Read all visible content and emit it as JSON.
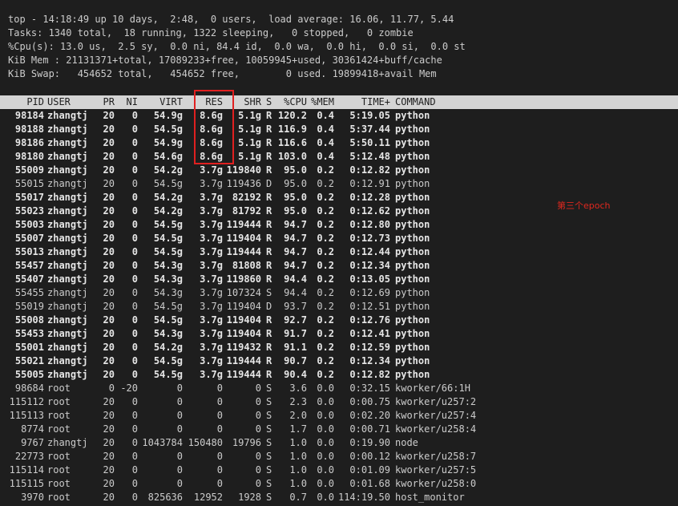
{
  "summary": [
    "top - 14:18:49 up 10 days,  2:48,  0 users,  load average: 16.06, 11.77, 5.44",
    "Tasks: 1340 total,  18 running, 1322 sleeping,   0 stopped,   0 zombie",
    "%Cpu(s): 13.0 us,  2.5 sy,  0.0 ni, 84.4 id,  0.0 wa,  0.0 hi,  0.0 si,  0.0 st",
    "KiB Mem : 21131371+total, 17089233+free, 10059945+used, 30361424+buff/cache",
    "KiB Swap:   454652 total,   454652 free,        0 used. 19899418+avail Mem"
  ],
  "columns": [
    "PID",
    "USER",
    "PR",
    "NI",
    "VIRT",
    "RES",
    "SHR",
    "S",
    "%CPU",
    "%MEM",
    "TIME+",
    "COMMAND"
  ],
  "processes": [
    {
      "pid": "98184",
      "user": "zhangtj",
      "pr": "20",
      "ni": "0",
      "virt": "54.9g",
      "res": "8.6g",
      "shr": "5.1g",
      "s": "R",
      "cpu": "120.2",
      "mem": "0.4",
      "time": "5:19.05",
      "cmd": "python",
      "bold": true
    },
    {
      "pid": "98188",
      "user": "zhangtj",
      "pr": "20",
      "ni": "0",
      "virt": "54.5g",
      "res": "8.6g",
      "shr": "5.1g",
      "s": "R",
      "cpu": "116.9",
      "mem": "0.4",
      "time": "5:37.44",
      "cmd": "python",
      "bold": true
    },
    {
      "pid": "98186",
      "user": "zhangtj",
      "pr": "20",
      "ni": "0",
      "virt": "54.9g",
      "res": "8.6g",
      "shr": "5.1g",
      "s": "R",
      "cpu": "116.6",
      "mem": "0.4",
      "time": "5:50.11",
      "cmd": "python",
      "bold": true
    },
    {
      "pid": "98180",
      "user": "zhangtj",
      "pr": "20",
      "ni": "0",
      "virt": "54.6g",
      "res": "8.6g",
      "shr": "5.1g",
      "s": "R",
      "cpu": "103.0",
      "mem": "0.4",
      "time": "5:12.48",
      "cmd": "python",
      "bold": true
    },
    {
      "pid": "55009",
      "user": "zhangtj",
      "pr": "20",
      "ni": "0",
      "virt": "54.2g",
      "res": "3.7g",
      "shr": "119840",
      "s": "R",
      "cpu": "95.0",
      "mem": "0.2",
      "time": "0:12.82",
      "cmd": "python",
      "bold": true
    },
    {
      "pid": "55015",
      "user": "zhangtj",
      "pr": "20",
      "ni": "0",
      "virt": "54.5g",
      "res": "3.7g",
      "shr": "119436",
      "s": "D",
      "cpu": "95.0",
      "mem": "0.2",
      "time": "0:12.91",
      "cmd": "python",
      "bold": false
    },
    {
      "pid": "55017",
      "user": "zhangtj",
      "pr": "20",
      "ni": "0",
      "virt": "54.2g",
      "res": "3.7g",
      "shr": "82192",
      "s": "R",
      "cpu": "95.0",
      "mem": "0.2",
      "time": "0:12.28",
      "cmd": "python",
      "bold": true
    },
    {
      "pid": "55023",
      "user": "zhangtj",
      "pr": "20",
      "ni": "0",
      "virt": "54.2g",
      "res": "3.7g",
      "shr": "81792",
      "s": "R",
      "cpu": "95.0",
      "mem": "0.2",
      "time": "0:12.62",
      "cmd": "python",
      "bold": true
    },
    {
      "pid": "55003",
      "user": "zhangtj",
      "pr": "20",
      "ni": "0",
      "virt": "54.5g",
      "res": "3.7g",
      "shr": "119444",
      "s": "R",
      "cpu": "94.7",
      "mem": "0.2",
      "time": "0:12.80",
      "cmd": "python",
      "bold": true
    },
    {
      "pid": "55007",
      "user": "zhangtj",
      "pr": "20",
      "ni": "0",
      "virt": "54.5g",
      "res": "3.7g",
      "shr": "119404",
      "s": "R",
      "cpu": "94.7",
      "mem": "0.2",
      "time": "0:12.73",
      "cmd": "python",
      "bold": true
    },
    {
      "pid": "55013",
      "user": "zhangtj",
      "pr": "20",
      "ni": "0",
      "virt": "54.5g",
      "res": "3.7g",
      "shr": "119444",
      "s": "R",
      "cpu": "94.7",
      "mem": "0.2",
      "time": "0:12.44",
      "cmd": "python",
      "bold": true
    },
    {
      "pid": "55457",
      "user": "zhangtj",
      "pr": "20",
      "ni": "0",
      "virt": "54.3g",
      "res": "3.7g",
      "shr": "81808",
      "s": "R",
      "cpu": "94.7",
      "mem": "0.2",
      "time": "0:12.34",
      "cmd": "python",
      "bold": true
    },
    {
      "pid": "55407",
      "user": "zhangtj",
      "pr": "20",
      "ni": "0",
      "virt": "54.3g",
      "res": "3.7g",
      "shr": "119860",
      "s": "R",
      "cpu": "94.4",
      "mem": "0.2",
      "time": "0:13.05",
      "cmd": "python",
      "bold": true
    },
    {
      "pid": "55455",
      "user": "zhangtj",
      "pr": "20",
      "ni": "0",
      "virt": "54.3g",
      "res": "3.7g",
      "shr": "107324",
      "s": "S",
      "cpu": "94.4",
      "mem": "0.2",
      "time": "0:12.69",
      "cmd": "python",
      "bold": false
    },
    {
      "pid": "55019",
      "user": "zhangtj",
      "pr": "20",
      "ni": "0",
      "virt": "54.5g",
      "res": "3.7g",
      "shr": "119404",
      "s": "D",
      "cpu": "93.7",
      "mem": "0.2",
      "time": "0:12.51",
      "cmd": "python",
      "bold": false
    },
    {
      "pid": "55008",
      "user": "zhangtj",
      "pr": "20",
      "ni": "0",
      "virt": "54.5g",
      "res": "3.7g",
      "shr": "119404",
      "s": "R",
      "cpu": "92.7",
      "mem": "0.2",
      "time": "0:12.76",
      "cmd": "python",
      "bold": true
    },
    {
      "pid": "55453",
      "user": "zhangtj",
      "pr": "20",
      "ni": "0",
      "virt": "54.3g",
      "res": "3.7g",
      "shr": "119404",
      "s": "R",
      "cpu": "91.7",
      "mem": "0.2",
      "time": "0:12.41",
      "cmd": "python",
      "bold": true
    },
    {
      "pid": "55001",
      "user": "zhangtj",
      "pr": "20",
      "ni": "0",
      "virt": "54.2g",
      "res": "3.7g",
      "shr": "119432",
      "s": "R",
      "cpu": "91.1",
      "mem": "0.2",
      "time": "0:12.59",
      "cmd": "python",
      "bold": true
    },
    {
      "pid": "55021",
      "user": "zhangtj",
      "pr": "20",
      "ni": "0",
      "virt": "54.5g",
      "res": "3.7g",
      "shr": "119444",
      "s": "R",
      "cpu": "90.7",
      "mem": "0.2",
      "time": "0:12.34",
      "cmd": "python",
      "bold": true
    },
    {
      "pid": "55005",
      "user": "zhangtj",
      "pr": "20",
      "ni": "0",
      "virt": "54.5g",
      "res": "3.7g",
      "shr": "119444",
      "s": "R",
      "cpu": "90.4",
      "mem": "0.2",
      "time": "0:12.82",
      "cmd": "python",
      "bold": true
    },
    {
      "pid": "98684",
      "user": "root",
      "pr": "0",
      "ni": "-20",
      "virt": "0",
      "res": "0",
      "shr": "0",
      "s": "S",
      "cpu": "3.6",
      "mem": "0.0",
      "time": "0:32.15",
      "cmd": "kworker/66:1H",
      "bold": false
    },
    {
      "pid": "115112",
      "user": "root",
      "pr": "20",
      "ni": "0",
      "virt": "0",
      "res": "0",
      "shr": "0",
      "s": "S",
      "cpu": "2.3",
      "mem": "0.0",
      "time": "0:00.75",
      "cmd": "kworker/u257:2",
      "bold": false
    },
    {
      "pid": "115113",
      "user": "root",
      "pr": "20",
      "ni": "0",
      "virt": "0",
      "res": "0",
      "shr": "0",
      "s": "S",
      "cpu": "2.0",
      "mem": "0.0",
      "time": "0:02.20",
      "cmd": "kworker/u257:4",
      "bold": false
    },
    {
      "pid": "8774",
      "user": "root",
      "pr": "20",
      "ni": "0",
      "virt": "0",
      "res": "0",
      "shr": "0",
      "s": "S",
      "cpu": "1.7",
      "mem": "0.0",
      "time": "0:00.71",
      "cmd": "kworker/u258:4",
      "bold": false
    },
    {
      "pid": "9767",
      "user": "zhangtj",
      "pr": "20",
      "ni": "0",
      "virt": "1043784",
      "res": "150480",
      "shr": "19796",
      "s": "S",
      "cpu": "1.0",
      "mem": "0.0",
      "time": "0:19.90",
      "cmd": "node",
      "bold": false
    },
    {
      "pid": "22773",
      "user": "root",
      "pr": "20",
      "ni": "0",
      "virt": "0",
      "res": "0",
      "shr": "0",
      "s": "S",
      "cpu": "1.0",
      "mem": "0.0",
      "time": "0:00.12",
      "cmd": "kworker/u258:7",
      "bold": false
    },
    {
      "pid": "115114",
      "user": "root",
      "pr": "20",
      "ni": "0",
      "virt": "0",
      "res": "0",
      "shr": "0",
      "s": "S",
      "cpu": "1.0",
      "mem": "0.0",
      "time": "0:01.09",
      "cmd": "kworker/u257:5",
      "bold": false
    },
    {
      "pid": "115115",
      "user": "root",
      "pr": "20",
      "ni": "0",
      "virt": "0",
      "res": "0",
      "shr": "0",
      "s": "S",
      "cpu": "1.0",
      "mem": "0.0",
      "time": "0:01.68",
      "cmd": "kworker/u258:0",
      "bold": false
    },
    {
      "pid": "3970",
      "user": "root",
      "pr": "20",
      "ni": "0",
      "virt": "825636",
      "res": "12952",
      "shr": "1928",
      "s": "S",
      "cpu": "0.7",
      "mem": "0.0",
      "time": "114:19.50",
      "cmd": "host_monitor",
      "bold": false
    }
  ],
  "annotation": "第三个epoch",
  "colors": {
    "background": "#1e1e1e",
    "text": "#cccccc",
    "header_bar": "#d4d4d4",
    "highlight": "#e02020",
    "annotation": "#e0281e"
  }
}
